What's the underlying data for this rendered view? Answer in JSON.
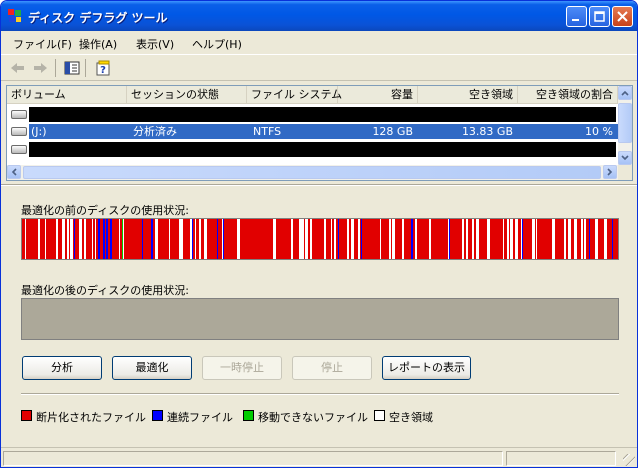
{
  "window": {
    "title": "ディスク デフラグ ツール"
  },
  "menu": [
    {
      "label": "ファイル(F)"
    },
    {
      "label": "操作(A)"
    },
    {
      "label": "表示(V)"
    },
    {
      "label": "ヘルプ(H)"
    }
  ],
  "toolbar": {
    "icons": [
      "back-arrow-icon",
      "forward-arrow-icon",
      "show-hide-console-tree-icon",
      "help-icon"
    ]
  },
  "volumes": {
    "columns": [
      "ボリューム",
      "セッションの状態",
      "ファイル システム",
      "容量",
      "空き領域",
      "空き領域の割合"
    ],
    "rows": [
      {
        "redacted": true
      },
      {
        "volume": "(J:)",
        "state": "分析済み",
        "fs": "NTFS",
        "capacity": "128 GB",
        "free": "13.83 GB",
        "free_pct": "10 %",
        "selected": true
      },
      {
        "redacted": true
      }
    ]
  },
  "analysis": {
    "before_label": "最適化の前のディスクの使用状況:",
    "after_label": "最適化の後のディスクの使用状況:"
  },
  "buttons": {
    "analyze": "分析",
    "defragment": "最適化",
    "pause": "一時停止",
    "stop": "停止",
    "report": "レポートの表示"
  },
  "legend": [
    {
      "label": "断片化されたファイル",
      "color": "#e10000"
    },
    {
      "label": "連続ファイル",
      "color": "#0000ff"
    },
    {
      "label": "移動できないファイル",
      "color": "#00cc00"
    },
    {
      "label": "空き領域",
      "color": "#ffffff"
    }
  ],
  "colors": {
    "fragmented": "#e10000",
    "contiguous": "#0000ff",
    "unmovable": "#00cc00",
    "free": "#ffffff",
    "selection": "#316ac5"
  }
}
